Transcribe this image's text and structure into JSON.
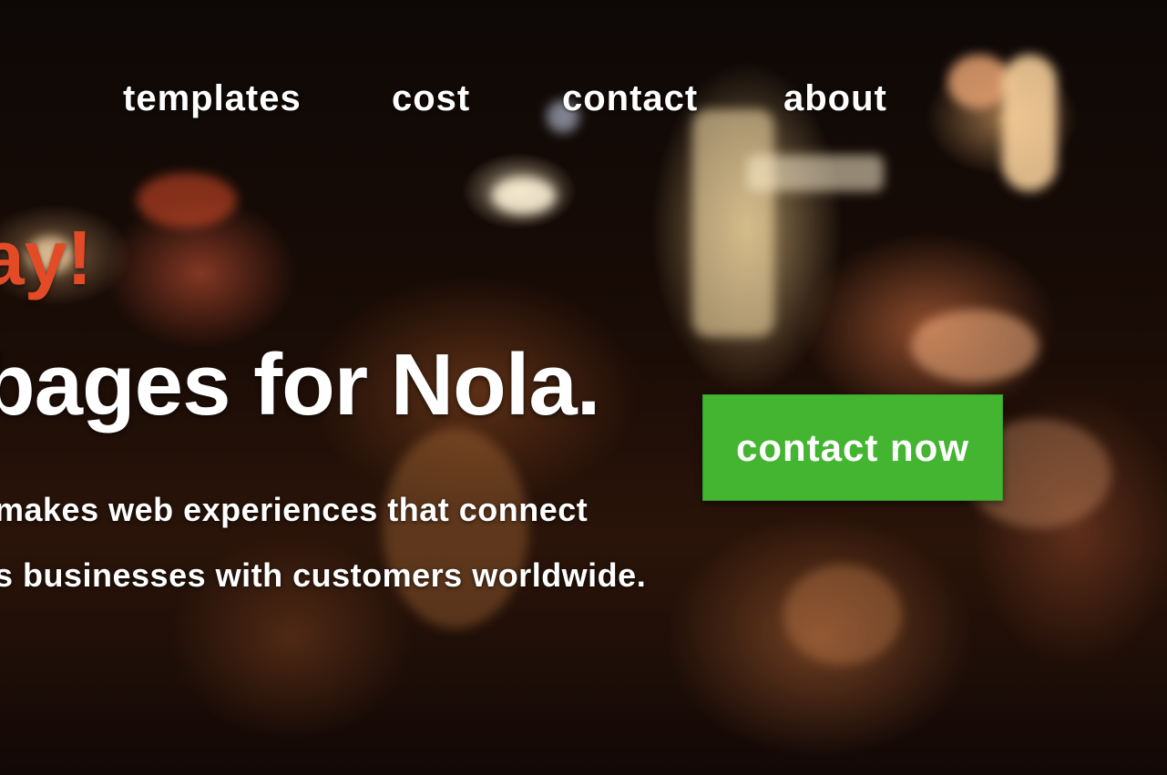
{
  "nav": {
    "items": [
      {
        "label": "templates"
      },
      {
        "label": "cost"
      },
      {
        "label": "contact"
      },
      {
        "label": "about"
      }
    ]
  },
  "hero": {
    "accent_text": "ay!",
    "headline": "bages for Nola.",
    "tagline_line1": "makes web experiences that connect",
    "tagline_line2": "s businesses with customers worldwide.",
    "cta_label": "contact now"
  },
  "colors": {
    "accent": "#e24b25",
    "cta_green": "#43b530",
    "text": "#ffffff",
    "background": "#0d0806"
  }
}
